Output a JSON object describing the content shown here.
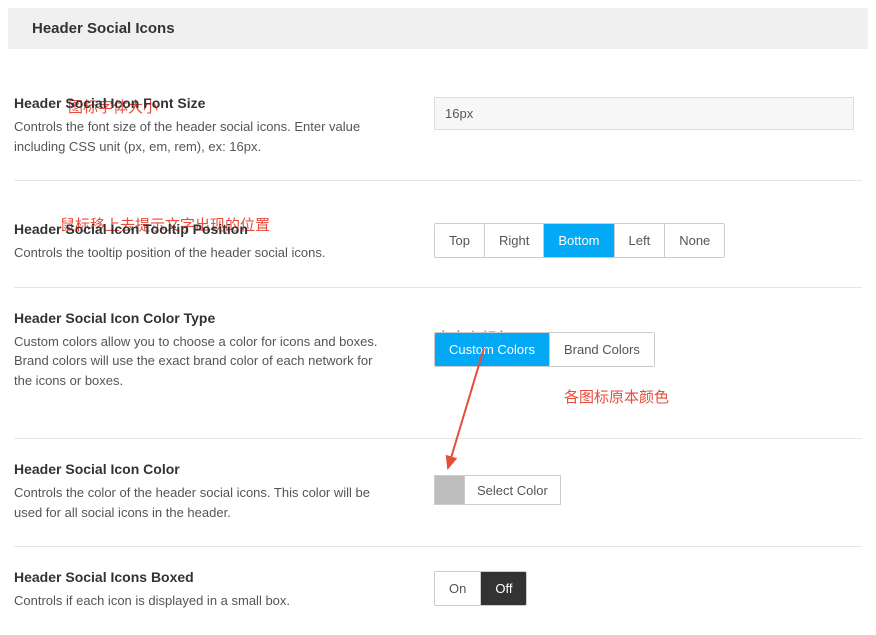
{
  "section_title": "Header Social Icons",
  "annotations": {
    "font_size": "图标字体大小",
    "tooltip_position": "鼠标移上去提示文字出现的位置",
    "custom_colors": "自定义颜色",
    "brand_colors": "各图标原本颜色"
  },
  "rows": {
    "font_size": {
      "title": "Header Social Icon Font Size",
      "desc": "Controls the font size of the header social icons. Enter value including CSS unit (px, em, rem), ex: 16px.",
      "value": "16px"
    },
    "tooltip": {
      "title": "Header Social Icon Tooltip Position",
      "desc": "Controls the tooltip position of the header social icons.",
      "options": {
        "top": "Top",
        "right": "Right",
        "bottom": "Bottom",
        "left": "Left",
        "none": "None"
      }
    },
    "color_type": {
      "title": "Header Social Icon Color Type",
      "desc": "Custom colors allow you to choose a color for icons and boxes. Brand colors will use the exact brand color of each network for the icons or boxes.",
      "options": {
        "custom": "Custom Colors",
        "brand": "Brand Colors"
      }
    },
    "icon_color": {
      "title": "Header Social Icon Color",
      "desc": "Controls the color of the header social icons. This color will be used for all social icons in the header.",
      "select_label": "Select Color"
    },
    "boxed": {
      "title": "Header Social Icons Boxed",
      "desc": "Controls if each icon is displayed in a small box.",
      "options": {
        "on": "On",
        "off": "Off"
      }
    }
  }
}
